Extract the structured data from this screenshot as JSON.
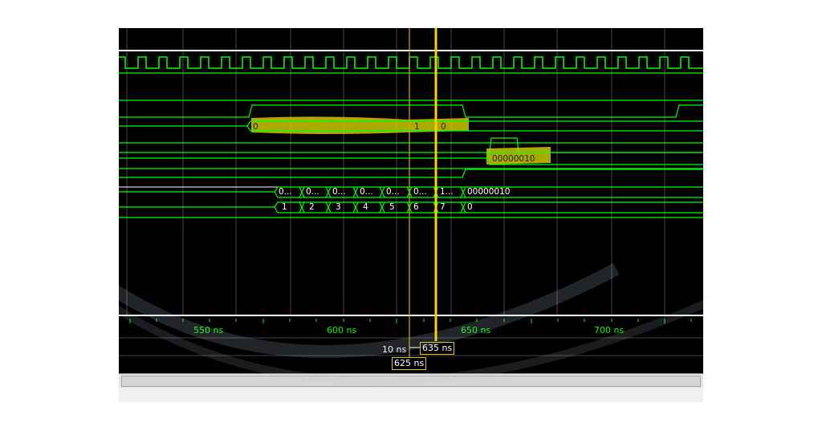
{
  "colors": {
    "background": "#000000",
    "signal": "#00ff00",
    "highlight": "#d4d400",
    "cursor": "#ffd000",
    "grid": "#5a5a5a",
    "text": "#ffffff"
  },
  "timeline": {
    "ticks": [
      {
        "label": "550 ns"
      },
      {
        "label": "600 ns"
      },
      {
        "label": "650 ns"
      },
      {
        "label": "700 ns"
      }
    ]
  },
  "cursors": {
    "main_label": "635 ns",
    "secondary_label": "625 ns",
    "delta_label": "10 ns"
  },
  "signals": {
    "row1_value_a": "0",
    "row1_value_b": "1",
    "row1_value_c": "0",
    "row2_value": "00000010",
    "bus1_values": [
      "0...",
      "0...",
      "0...",
      "0...",
      "0...",
      "0...",
      "1...",
      "00000010"
    ],
    "bus2_values": [
      "1",
      "2",
      "3",
      "4",
      "5",
      "6",
      "7",
      "0"
    ]
  }
}
